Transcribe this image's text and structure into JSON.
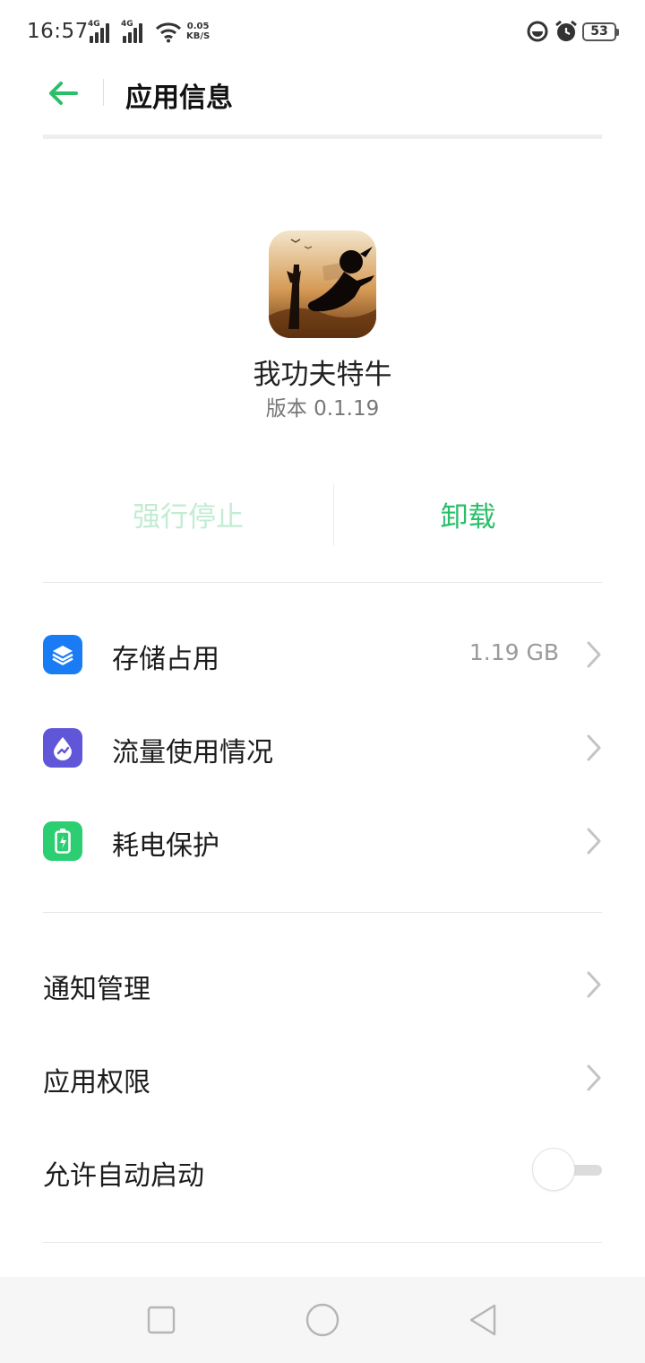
{
  "status_bar": {
    "time": "16:57",
    "signal1_tag": "4G",
    "signal2_tag": "4G",
    "net_speed_value": "0.05",
    "net_speed_unit": "KB/S",
    "battery_level": "53"
  },
  "header": {
    "title": "应用信息"
  },
  "app": {
    "name": "我功夫特牛",
    "version": "版本 0.1.19"
  },
  "actions": {
    "force_stop": "强行停止",
    "uninstall": "卸载"
  },
  "rows": [
    {
      "label": "存储占用",
      "value": "1.19 GB",
      "icon": "storage-layers-icon",
      "icon_color": "#1a7cf5"
    },
    {
      "label": "流量使用情况",
      "value": "",
      "icon": "data-usage-drop-icon",
      "icon_color": "#6057d8"
    },
    {
      "label": "耗电保护",
      "value": "",
      "icon": "battery-protect-icon",
      "icon_color": "#2cce72"
    }
  ],
  "settings": [
    {
      "label": "通知管理"
    },
    {
      "label": "应用权限"
    },
    {
      "label": "允许自动启动",
      "toggle": false
    }
  ],
  "colors": {
    "accent": "#2bbf6a",
    "accent_disabled": "#c2ecd3"
  }
}
